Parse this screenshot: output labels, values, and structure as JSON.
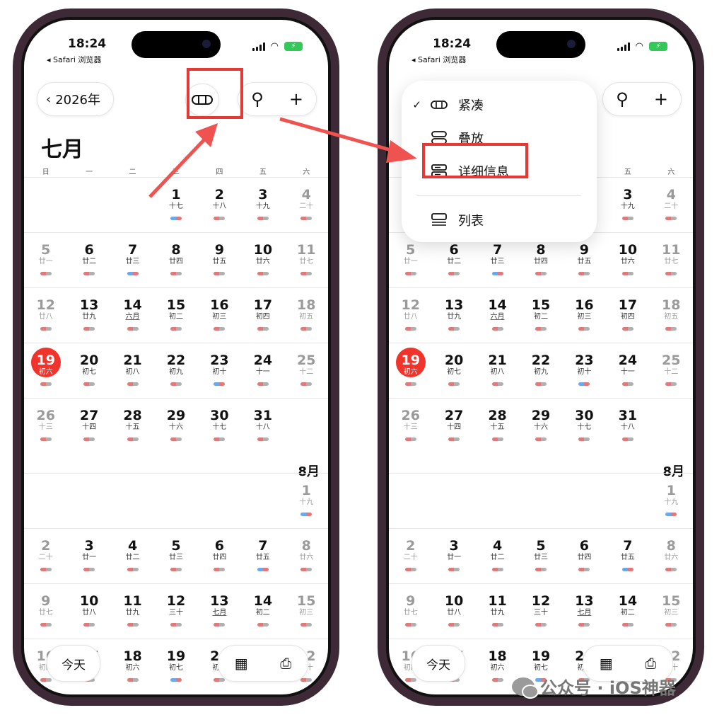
{
  "status": {
    "time": "18:24",
    "back_label": "◂ Safari 浏览器",
    "battery": "⚡"
  },
  "header": {
    "back_year": "2026年"
  },
  "month": {
    "title": "七月",
    "next_label": "8月"
  },
  "weekdays": [
    "日",
    "一",
    "二",
    "三",
    "四",
    "五",
    "六"
  ],
  "left_rows": [
    [
      {
        "d": "",
        "l": ""
      },
      {
        "d": "",
        "l": ""
      },
      {
        "d": "",
        "l": ""
      },
      {
        "d": "1",
        "l": "十七"
      },
      {
        "d": "2",
        "l": "十八"
      },
      {
        "d": "3",
        "l": "十九"
      },
      {
        "d": "4",
        "l": "二十"
      }
    ],
    [
      {
        "d": "5",
        "l": "廿一"
      },
      {
        "d": "6",
        "l": "廿二"
      },
      {
        "d": "7",
        "l": "廿三"
      },
      {
        "d": "8",
        "l": "廿四"
      },
      {
        "d": "9",
        "l": "廿五"
      },
      {
        "d": "10",
        "l": "廿六"
      },
      {
        "d": "11",
        "l": "廿七"
      }
    ],
    [
      {
        "d": "12",
        "l": "廿八"
      },
      {
        "d": "13",
        "l": "廿九"
      },
      {
        "d": "14",
        "l": "六月"
      },
      {
        "d": "15",
        "l": "初二"
      },
      {
        "d": "16",
        "l": "初三"
      },
      {
        "d": "17",
        "l": "初四"
      },
      {
        "d": "18",
        "l": "初五"
      }
    ],
    [
      {
        "d": "19",
        "l": "初六"
      },
      {
        "d": "20",
        "l": "初七"
      },
      {
        "d": "21",
        "l": "初八"
      },
      {
        "d": "22",
        "l": "初九"
      },
      {
        "d": "23",
        "l": "初十"
      },
      {
        "d": "24",
        "l": "十一"
      },
      {
        "d": "25",
        "l": "十二"
      }
    ],
    [
      {
        "d": "26",
        "l": "十三"
      },
      {
        "d": "27",
        "l": "十四"
      },
      {
        "d": "28",
        "l": "十五"
      },
      {
        "d": "29",
        "l": "十六"
      },
      {
        "d": "30",
        "l": "十七"
      },
      {
        "d": "31",
        "l": "十八"
      },
      {
        "d": "",
        "l": ""
      }
    ]
  ],
  "aug_rows": [
    [
      {
        "d": "",
        "l": ""
      },
      {
        "d": "",
        "l": ""
      },
      {
        "d": "",
        "l": ""
      },
      {
        "d": "",
        "l": ""
      },
      {
        "d": "",
        "l": ""
      },
      {
        "d": "",
        "l": ""
      },
      {
        "d": "1",
        "l": "十九"
      }
    ],
    [
      {
        "d": "2",
        "l": "二十"
      },
      {
        "d": "3",
        "l": "廿一"
      },
      {
        "d": "4",
        "l": "廿二"
      },
      {
        "d": "5",
        "l": "廿三"
      },
      {
        "d": "6",
        "l": "廿四"
      },
      {
        "d": "7",
        "l": "廿五"
      },
      {
        "d": "8",
        "l": "廿六"
      }
    ],
    [
      {
        "d": "9",
        "l": "廿七"
      },
      {
        "d": "10",
        "l": "廿八"
      },
      {
        "d": "11",
        "l": "廿九"
      },
      {
        "d": "12",
        "l": "三十"
      },
      {
        "d": "13",
        "l": "七月"
      },
      {
        "d": "14",
        "l": "初二"
      },
      {
        "d": "15",
        "l": "初三"
      }
    ],
    [
      {
        "d": "16",
        "l": "初四"
      },
      {
        "d": "17",
        "l": "初五"
      },
      {
        "d": "18",
        "l": "初六"
      },
      {
        "d": "19",
        "l": "初七"
      },
      {
        "d": "20",
        "l": "初八"
      },
      {
        "d": "21",
        "l": "初九"
      },
      {
        "d": "22",
        "l": "初十"
      }
    ]
  ],
  "bottom": {
    "today_label": "今天"
  },
  "menu": {
    "items": [
      {
        "label": "紧凑",
        "checked": true
      },
      {
        "label": "叠放",
        "checked": false
      },
      {
        "label": "详细信息",
        "checked": false
      },
      {
        "label": "列表",
        "checked": false
      }
    ]
  },
  "watermark": {
    "text": "公众号 · iOS神器"
  },
  "colors": {
    "today": "#f0342c",
    "highlight": "#e53935",
    "frame": "#3d2a36"
  }
}
